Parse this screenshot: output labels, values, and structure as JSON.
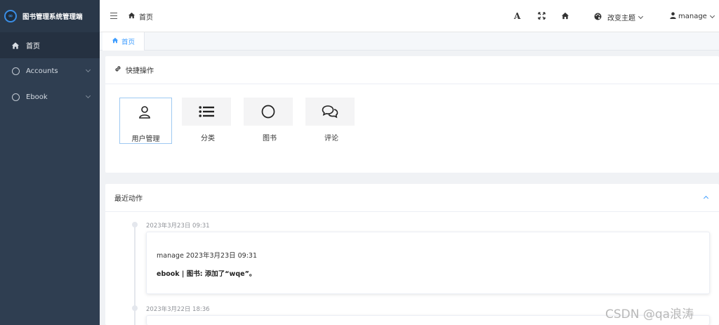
{
  "brand": {
    "logo_text": "∞",
    "title": "图书管理系统管理端"
  },
  "sidebar": {
    "items": [
      {
        "label": "首页",
        "active": true
      },
      {
        "label": "Accounts"
      },
      {
        "label": "Ebook"
      }
    ]
  },
  "header": {
    "breadcrumb": "首页",
    "font_icon_text": "A",
    "theme_label": "改变主题",
    "user_label": "manage"
  },
  "tabs": [
    {
      "label": "首页"
    }
  ],
  "quick": {
    "title": "快捷操作",
    "items": [
      {
        "label": "用户管理",
        "icon": "user-icon"
      },
      {
        "label": "分类",
        "icon": "list-icon"
      },
      {
        "label": "图书",
        "icon": "circle-icon"
      },
      {
        "label": "评论",
        "icon": "comments-icon"
      }
    ]
  },
  "recent": {
    "title": "最近动作",
    "entries": [
      {
        "time": "2023年3月23日 09:31",
        "line1": "manage 2023年3月23日 09:31",
        "line2": "ebook | 图书: 添加了“wqe”。"
      },
      {
        "time": "2023年3月22日 18:36"
      }
    ]
  },
  "watermark": "CSDN @qa浪涛",
  "colors": {
    "sidebar": "#2f3e51",
    "accent": "#409eff",
    "background": "#f0f2f5"
  }
}
